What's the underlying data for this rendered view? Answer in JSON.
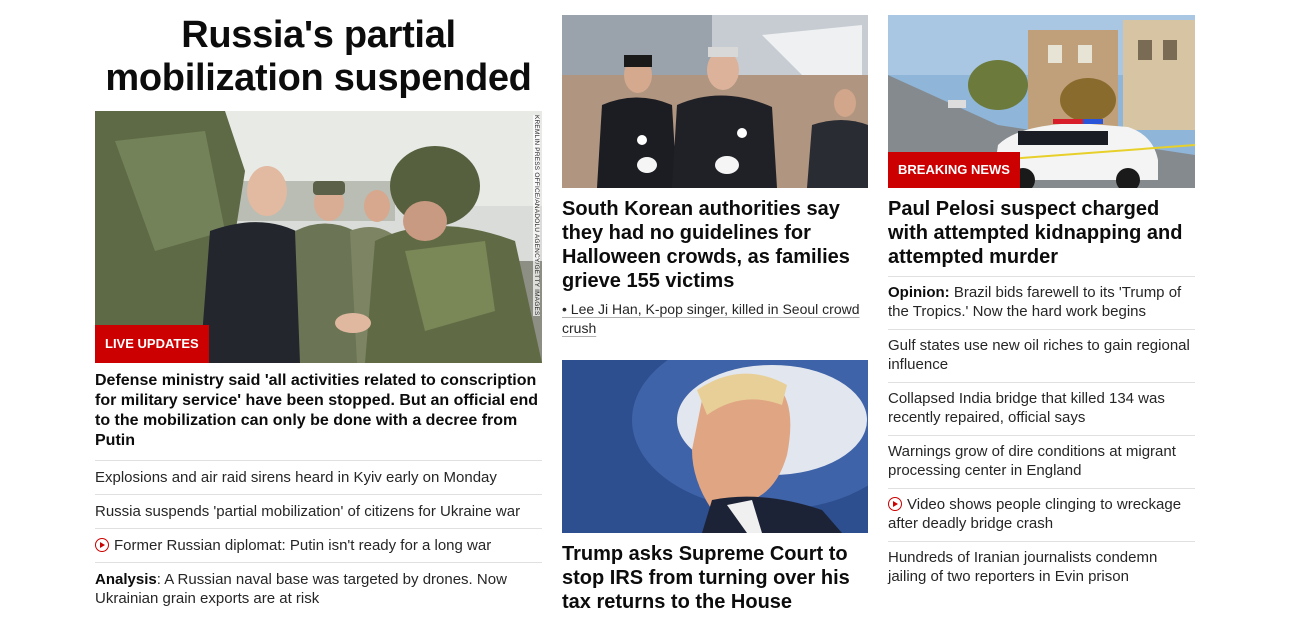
{
  "left": {
    "headline": "Russia's partial mobilization suspended",
    "photo_credit": "KREMLIN PRESS OFFICE/ANADOLU AGENCY/GETTY IMAGES",
    "badge": "LIVE UPDATES",
    "lead": "Defense ministry said 'all activities related to conscription for military service' have been stopped. But an official end to the mobilization can only be done with a decree from Putin",
    "links": [
      {
        "text": "Explosions and air raid sirens heard in Kyiv early on Monday"
      },
      {
        "text": "Russia suspends 'partial mobilization' of citizens for Ukraine war"
      },
      {
        "text": "Former Russian diplomat: Putin isn't ready for a long war",
        "icon": "video-play-icon"
      },
      {
        "prefix": "Analysis",
        "text": ": A Russian naval base was targeted by drones. Now Ukrainian grain exports are at risk"
      }
    ]
  },
  "middle": {
    "story1": {
      "title": "South Korean authorities say they had no guidelines for Halloween crowds, as families grieve 155 victims",
      "sublink": "• Lee Ji Han, K-pop singer, killed in Seoul crowd crush"
    },
    "story2": {
      "title": "Trump asks Supreme Court to stop IRS from turning over his tax returns to the House"
    }
  },
  "right": {
    "badge": "BREAKING NEWS",
    "title": "Paul Pelosi suspect charged with attempted kidnapping and attempted murder",
    "links": [
      {
        "prefix": "Opinion:",
        "text": " Brazil bids farewell to its 'Trump of the Tropics.' Now the hard work begins"
      },
      {
        "text": "Gulf states use new oil riches to gain regional influence"
      },
      {
        "text": "Collapsed India bridge that killed 134 was recently repaired, official says"
      },
      {
        "text": "Warnings grow of dire conditions at migrant processing center in England"
      },
      {
        "text": "Video shows people clinging to wreckage after deadly bridge crash",
        "icon": "video-play-icon"
      },
      {
        "text": "Hundreds of Iranian journalists condemn jailing of two reporters in Evin prison"
      }
    ]
  },
  "colors": {
    "accent": "#cc0000",
    "divider": "#e0e0e0",
    "text": "#0c0c0c"
  }
}
